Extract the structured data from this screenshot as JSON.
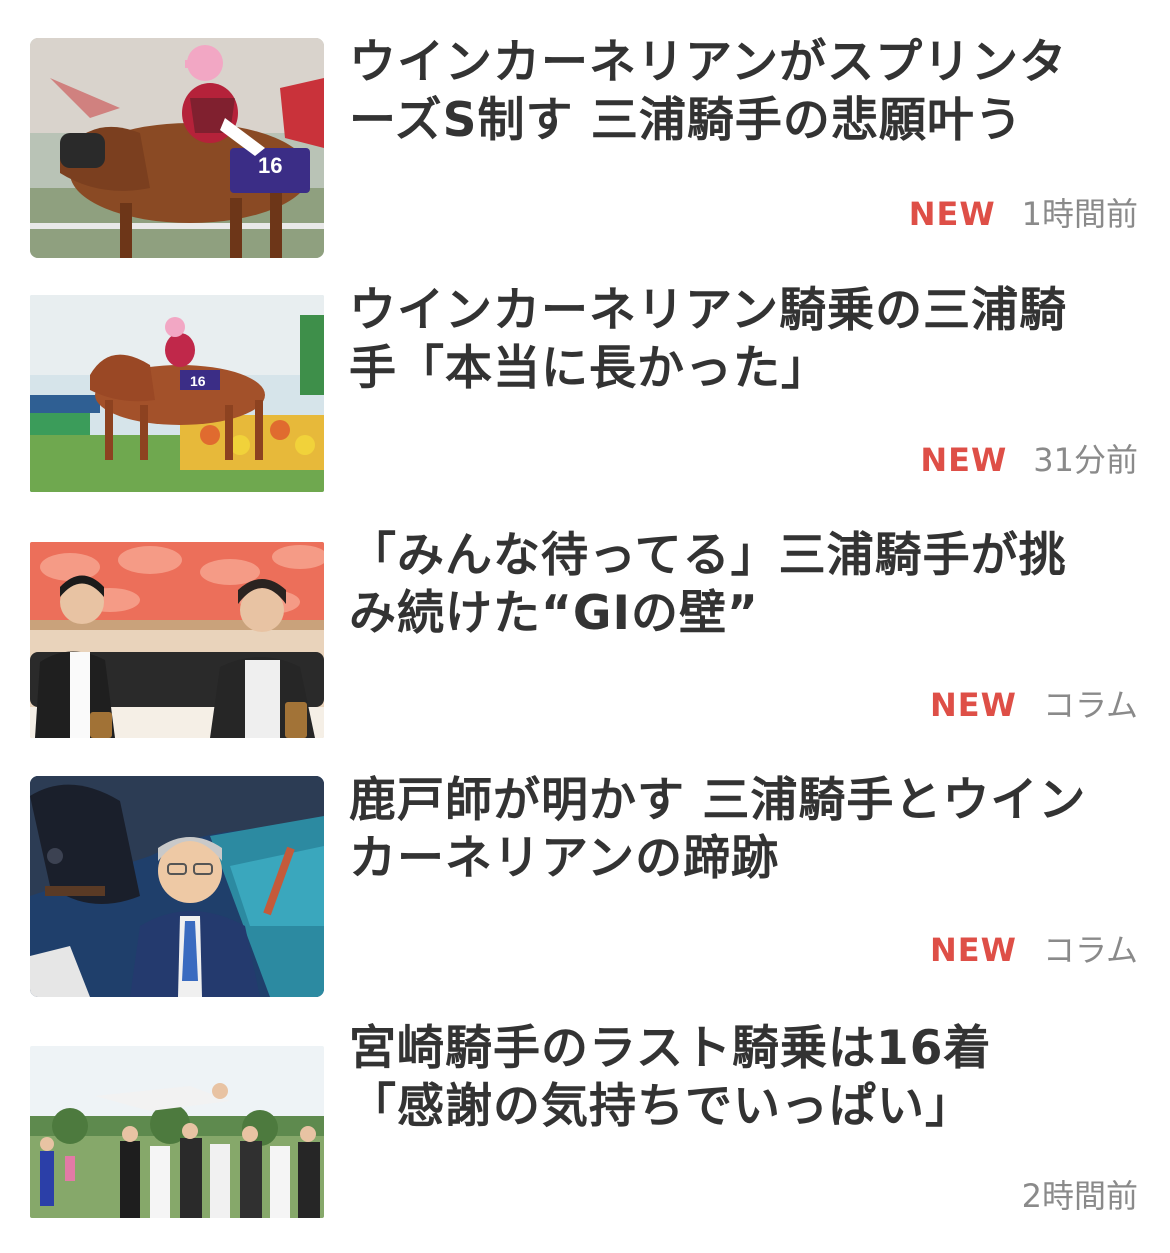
{
  "colors": {
    "title_text": "#333333",
    "new_badge": "#de4f47",
    "meta_text": "#8a8a8a",
    "background": "#ffffff"
  },
  "articles": [
    {
      "title_line1": "ウインカーネリアンがスプリンタ",
      "title_line2": "ーズS制す 三浦騎手の悲願叶う",
      "badge": "NEW",
      "time": "1時間前",
      "thumbnail": "jockey-riding-horse-photo"
    },
    {
      "title_line1": "ウインカーネリアン騎乗の三浦騎",
      "title_line2": "手「本当に長かった」",
      "badge": "NEW",
      "time": "31分前",
      "thumbnail": "racehorse-galloping-photo"
    },
    {
      "title_line1": "「みんな待ってる」三浦騎手が挑",
      "title_line2": "み続けた“GIの壁”",
      "badge": "NEW",
      "time": "コラム",
      "thumbnail": "interview-two-men-photo"
    },
    {
      "title_line1": "鹿戸師が明かす 三浦騎手とウイン",
      "title_line2": "カーネリアンの蹄跡",
      "badge": "NEW",
      "time": "コラム",
      "thumbnail": "trainer-with-horse-photo"
    },
    {
      "title_line1": "宮崎騎手のラスト騎乗は16着",
      "title_line2": "「感謝の気持ちでいっぱい」",
      "badge": "",
      "time": "2時間前",
      "thumbnail": "jockey-tossed-celebration-photo"
    }
  ]
}
